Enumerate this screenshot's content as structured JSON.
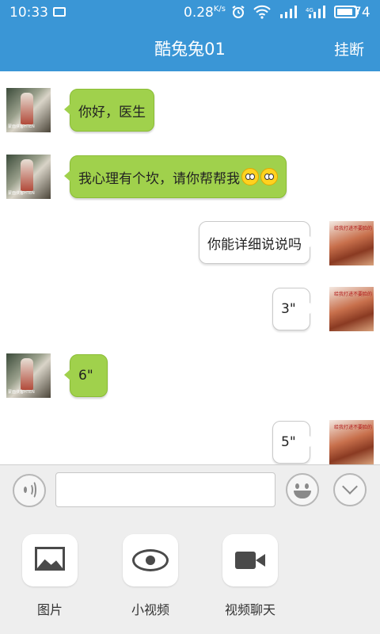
{
  "status_bar": {
    "time": "10:33",
    "net_speed": "0.28",
    "net_speed_unit": "K/s",
    "battery": "74",
    "icons": [
      "image-icon",
      "alarm-icon",
      "wifi-icon",
      "signal-icon",
      "signal-icon",
      "battery-icon"
    ]
  },
  "header": {
    "title": "酷兔兔01",
    "action_label": "挂断"
  },
  "messages": [
    {
      "side": "left",
      "text": "你好，医生"
    },
    {
      "side": "left",
      "text": "我心理有个坎，请你帮帮我",
      "emojis": 2
    },
    {
      "side": "right",
      "text": "你能详细说说吗"
    },
    {
      "side": "right",
      "text": "3\""
    },
    {
      "side": "left",
      "text": "6\""
    },
    {
      "side": "right",
      "text": "5\""
    }
  ],
  "input": {
    "value": "",
    "placeholder": ""
  },
  "tools": [
    {
      "label": "图片",
      "icon": "picture-icon"
    },
    {
      "label": "小视频",
      "icon": "eye-icon"
    },
    {
      "label": "视频聊天",
      "icon": "video-camera-icon"
    }
  ],
  "colors": {
    "accent": "#3a96d6",
    "bubble_left": "#a0d14c",
    "bubble_right": "#ffffff",
    "panel_bg": "#eeeeee"
  }
}
